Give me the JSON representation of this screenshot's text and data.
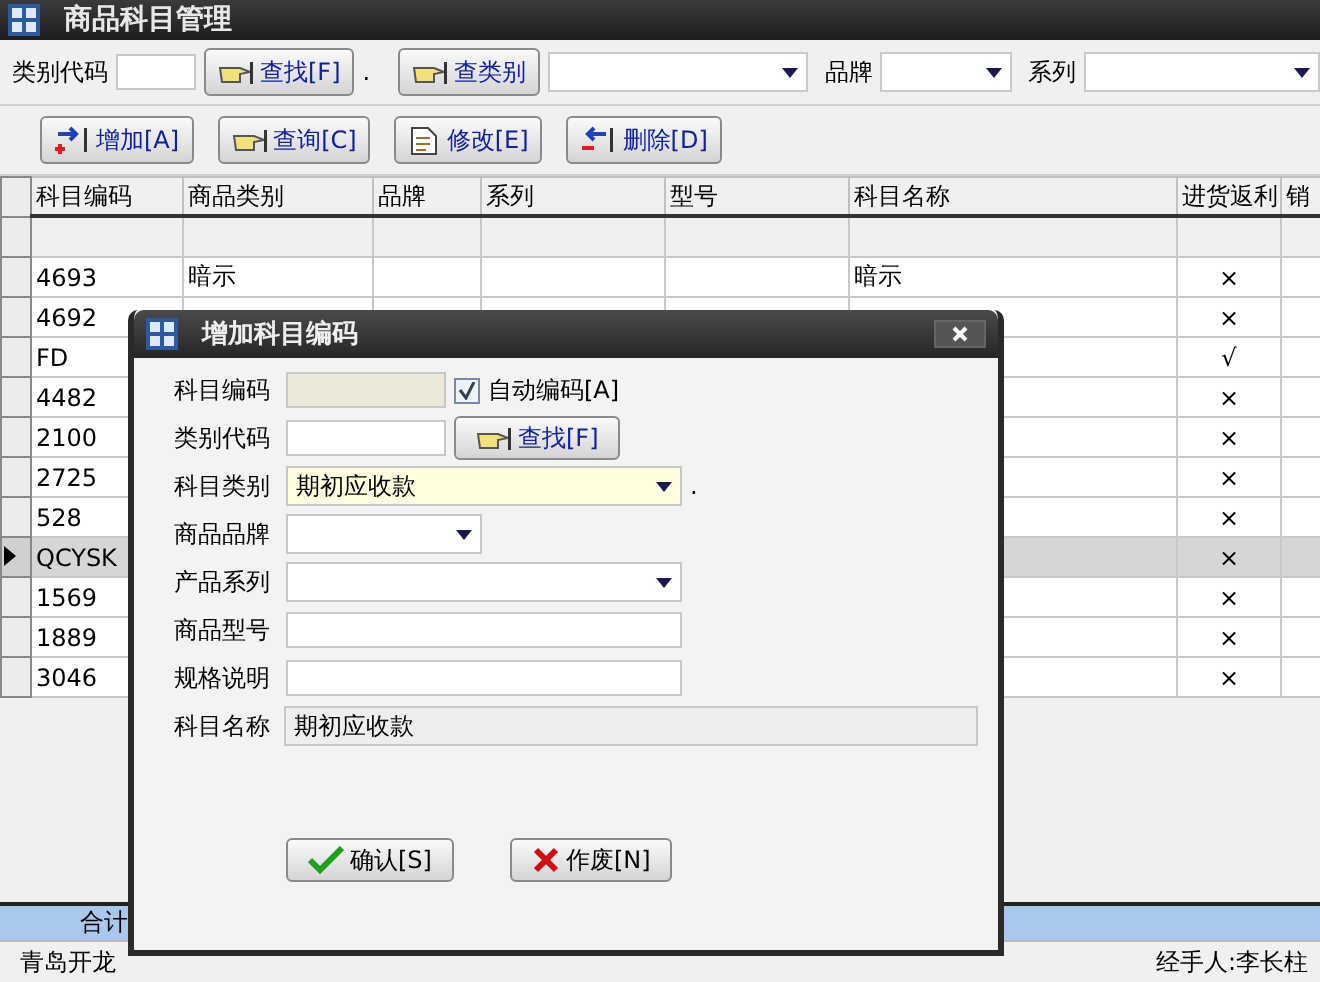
{
  "window": {
    "title": "商品科目管理"
  },
  "filter_bar": {
    "code_label": "类别代码",
    "find_button": "查找[F]",
    "dot": ".",
    "category_button": "查类别",
    "brand_label": "品牌",
    "series_label": "系列"
  },
  "actions": [
    {
      "kind": "add",
      "label": "增加[A]"
    },
    {
      "kind": "query",
      "label": "查询[C]"
    },
    {
      "kind": "edit",
      "label": "修改[E]"
    },
    {
      "kind": "delete",
      "label": "删除[D]"
    }
  ],
  "table": {
    "columns": [
      "科目编码",
      "商品类别",
      "品牌",
      "系列",
      "型号",
      "科目名称",
      "进货返利",
      "销"
    ],
    "rows": [
      {
        "code": "4693",
        "category": "暗示",
        "name": "暗示",
        "rebate": "×",
        "selected": false
      },
      {
        "code": "4692",
        "rebate": "×",
        "selected": false
      },
      {
        "code": "FD",
        "rebate": "√",
        "selected": false
      },
      {
        "code": "4482",
        "rebate": "×",
        "selected": false
      },
      {
        "code": "2100",
        "rebate": "×",
        "selected": false
      },
      {
        "code": "2725",
        "rebate": "×",
        "selected": false
      },
      {
        "code": "528",
        "rebate": "×",
        "selected": false
      },
      {
        "code": "QCYSK",
        "rebate": "×",
        "selected": true
      },
      {
        "code": "1569",
        "rebate": "×",
        "selected": false
      },
      {
        "code": "1889",
        "rebate": "×",
        "selected": false
      },
      {
        "code": "3046",
        "rebate": "×",
        "selected": false
      }
    ],
    "total_label": "合计"
  },
  "status_bar": {
    "company": "青岛开龙",
    "handler": "经手人:李长柱"
  },
  "dialog": {
    "title": "增加科目编码",
    "fields": [
      {
        "kind": "readonly-code",
        "label": "科目编码"
      },
      {
        "kind": "find",
        "label": "类别代码"
      },
      {
        "kind": "select-wide",
        "label": "科目类别",
        "value": "期初应收款"
      },
      {
        "kind": "select-short",
        "label": "商品品牌"
      },
      {
        "kind": "select",
        "label": "产品系列"
      },
      {
        "kind": "text",
        "label": "商品型号"
      },
      {
        "kind": "text",
        "label": "规格说明"
      },
      {
        "kind": "readonly",
        "label": "科目名称",
        "value": "期初应收款"
      }
    ],
    "auto_code": {
      "label": "自动编码[A]",
      "checked": true
    },
    "find_button": "查找[F]",
    "dot": ".",
    "confirm_button": "确认[S]",
    "cancel_button": "作废[N]"
  }
}
